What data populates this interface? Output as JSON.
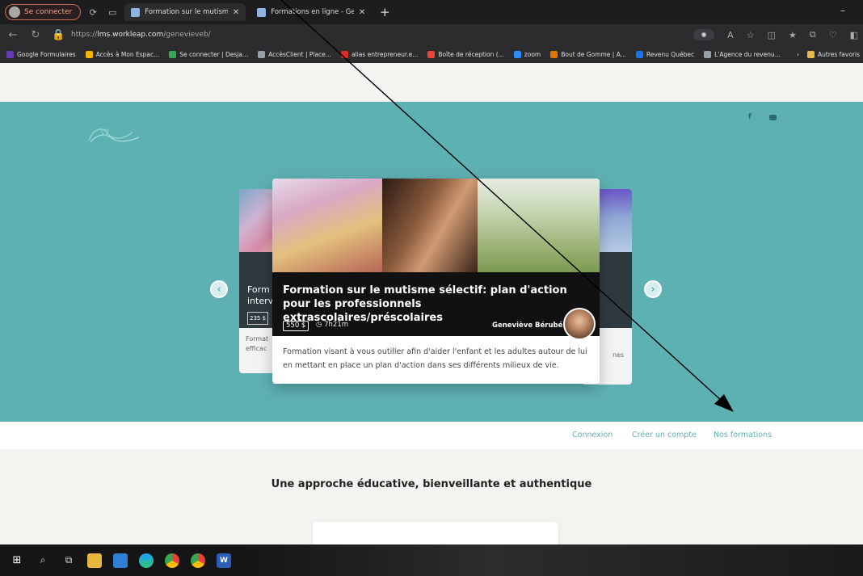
{
  "browser": {
    "profile_label": "Se connecter",
    "tabs": [
      {
        "label": "Formation sur le mutisme sélecti"
      },
      {
        "label": "Formations en ligne - Geneviève"
      }
    ],
    "new_tab": "+",
    "url_scheme": "https://",
    "url_host": "lms.workleap.com",
    "url_path": "/genevieveb/",
    "bookmarks": [
      {
        "label": "Google Formulaires",
        "color": "#673ab7"
      },
      {
        "label": "Accès à Mon Espac...",
        "color": "#f4b400"
      },
      {
        "label": "Se connecter | Desja...",
        "color": "#34a853"
      },
      {
        "label": "AccèsClient | Place...",
        "color": "#9aa0a6"
      },
      {
        "label": "alias entrepreneur.e...",
        "color": "#d93025"
      },
      {
        "label": "Boîte de réception (...",
        "color": "#ea4335"
      },
      {
        "label": "zoom",
        "color": "#2d8cff"
      },
      {
        "label": "Bout de Gomme | A...",
        "color": "#e37400"
      },
      {
        "label": "Revenu Québec",
        "color": "#1a73e8"
      },
      {
        "label": "L'Agence du revenu...",
        "color": "#9aa0a6"
      }
    ],
    "other_favorites": "Autres favoris"
  },
  "site": {
    "carousel": {
      "left_card": {
        "title": "Form interv",
        "price": "235 $",
        "desc": "Format efficac"
      },
      "right_card": {
        "desc": "nes"
      },
      "main_card": {
        "title": "Formation sur le mutisme sélectif: plan d'action pour les professionnels extrascolaires/préscolaires",
        "price": "550 $",
        "duration": "7h21m",
        "author": "Geneviève Bérubé",
        "description": "Formation visant à vous outiller afin d'aider l'enfant et les adultes autour de lui en mettant en place un plan d'action dans ses différents milieux de vie."
      }
    },
    "nav": {
      "login": "Connexion",
      "create_account": "Créer un compte",
      "our_courses": "Nos formations"
    },
    "tagline": "Une approche éducative, bienveillante et authentique",
    "colors": {
      "teal": "#5eb1b3",
      "dark": "#111111",
      "page_bg": "#f5f3f0"
    }
  },
  "taskbar": {
    "icons": [
      "windows-icon",
      "search-icon",
      "task-view-icon",
      "file-explorer-icon",
      "mail-icon",
      "edge-icon",
      "chrome-icon",
      "chrome-profile-icon",
      "word-icon"
    ]
  }
}
